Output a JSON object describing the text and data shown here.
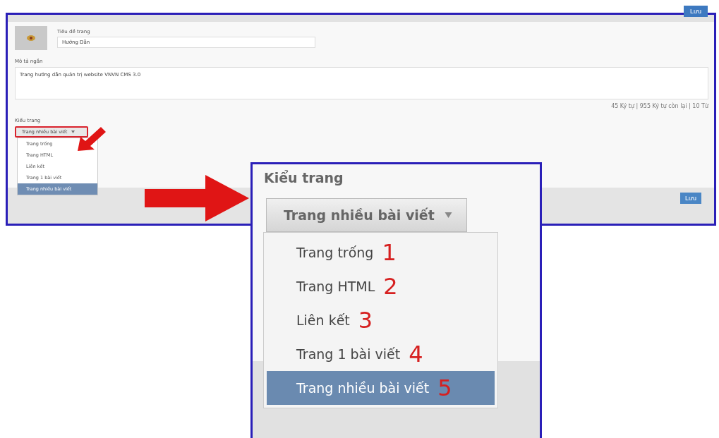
{
  "top_button": "Lưu",
  "form": {
    "title_label": "Tiêu đề trang",
    "title_value": "Hướng Dẫn",
    "summary_label": "Mô tả ngắn",
    "summary_value": "Trang hướng dẫn quản trị website VNVN CMS 3.0",
    "counter": "45 Ký tự | 955 Ký tự còn lại | 10 Từ",
    "page_type_label": "Kiểu trang",
    "page_type_value": "Trang nhiều bài viết",
    "options": [
      {
        "label": "Trang trống",
        "selected": false
      },
      {
        "label": "Trang HTML",
        "selected": false
      },
      {
        "label": "Liên kết",
        "selected": false
      },
      {
        "label": "Trang 1 bài viết",
        "selected": false
      },
      {
        "label": "Trang nhiều bài viết",
        "selected": true
      }
    ],
    "save_button": "Lưu"
  },
  "zoom_inset": {
    "label": "Kiểu trang",
    "value": "Trang nhiều bài viết",
    "options": [
      {
        "label": "Trang trống",
        "number": "1",
        "selected": false
      },
      {
        "label": "Trang HTML",
        "number": "2",
        "selected": false
      },
      {
        "label": "Liên kết",
        "number": "3",
        "selected": false
      },
      {
        "label": "Trang 1 bài viết",
        "number": "4",
        "selected": false
      },
      {
        "label": "Trang nhiều bài viết",
        "number": "5",
        "selected": true
      }
    ]
  }
}
